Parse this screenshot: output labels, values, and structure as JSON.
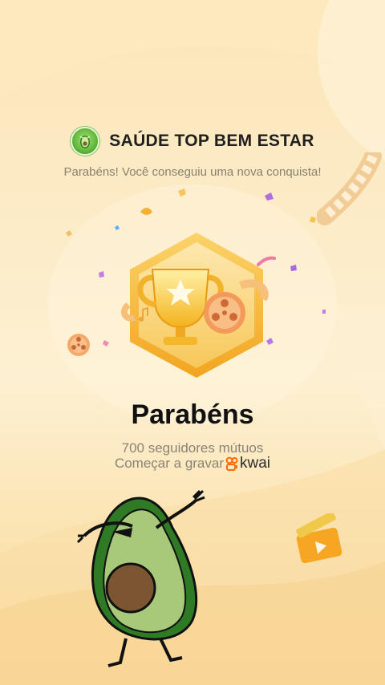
{
  "header": {
    "app_name": "SAÚDE TOP BEM ESTAR",
    "logo_icon": "avocado-logo-icon"
  },
  "subtitle": "Parabéns! Você conseguiu uma nova conquista!",
  "badge": {
    "icon": "trophy-film-reel-badge-icon"
  },
  "congrats_title": "Parabéns",
  "followers_text": "700 seguidores mútuos",
  "record_text": "Começar a gravar",
  "brand": {
    "name": "kwai",
    "icon": "kwai-logo-icon",
    "color": "#ff6a00"
  },
  "sticker": {
    "icon": "dabbing-avocado-icon"
  },
  "colors": {
    "background_top": "#fbe6b8",
    "background_bottom": "#f8d99a",
    "badge_gold": "#f6b52a",
    "title": "#111111",
    "secondary_text": "#8b8378"
  }
}
